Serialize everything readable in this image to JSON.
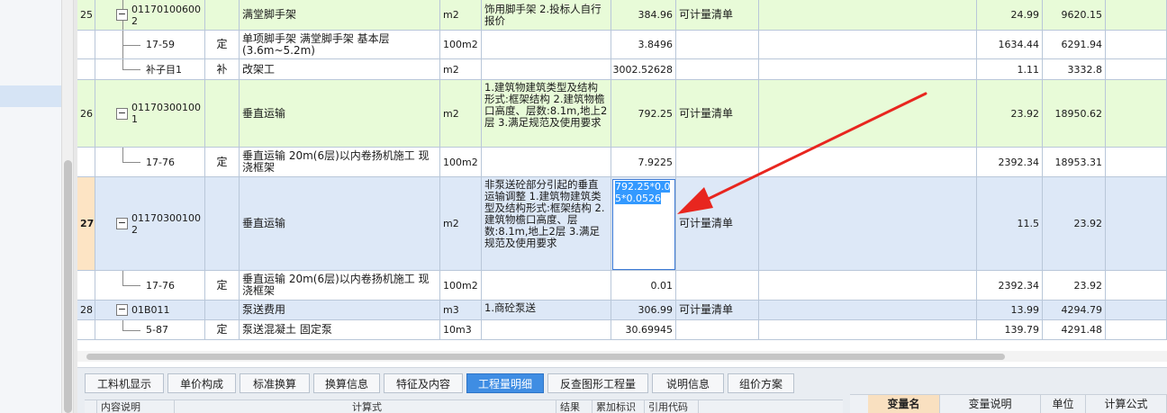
{
  "rows": [
    {
      "num": "25",
      "code": "01170100600 2",
      "name": "满堂脚手架",
      "unit": "m2",
      "features": "饰用脚手架 2.投标人自行报价",
      "qty": "384.96",
      "rule": "可计量清单",
      "price": "24.99",
      "total": "9620.15"
    },
    {
      "num": "",
      "code": "17-59",
      "cat": "定",
      "name": "单项脚手架 满堂脚手架 基本层(3.6m~5.2m)",
      "unit": "100m2",
      "features": "",
      "qty": "3.8496",
      "rule": "",
      "price": "1634.44",
      "total": "6291.94"
    },
    {
      "num": "",
      "code": "补子目1",
      "cat": "补",
      "name": "改架工",
      "unit": "m2",
      "features": "",
      "qty": "3002.52628",
      "rule": "",
      "price": "1.11",
      "total": "3332.8"
    },
    {
      "num": "26",
      "code": "01170300100 1",
      "name": "垂直运输",
      "unit": "m2",
      "features": "1.建筑物建筑类型及结构形式:框架结构 2.建筑物檐口高度、层数:8.1m,地上2层 3.满足规范及使用要求",
      "qty": "792.25",
      "rule": "可计量清单",
      "price": "23.92",
      "total": "18950.62"
    },
    {
      "num": "",
      "code": "17-76",
      "cat": "定",
      "name": "垂直运输 20m(6层)以内卷扬机施工 现浇框架",
      "unit": "100m2",
      "features": "",
      "qty": "7.9225",
      "rule": "",
      "price": "2392.34",
      "total": "18953.31"
    },
    {
      "num": "27",
      "code": "01170300100 2",
      "name": "垂直运输",
      "unit": "m2",
      "features": "非泵送砼部分引起的垂直运输调整 1.建筑物建筑类型及结构形式:框架结构 2.建筑物檐口高度、层数:8.1m,地上2层 3.满足规范及使用要求",
      "qty": "792.25*0.05*0.0526",
      "rule": "可计量清单",
      "price": "11.5",
      "total": "23.92"
    },
    {
      "num": "",
      "code": "17-76",
      "cat": "定",
      "name": "垂直运输 20m(6层)以内卷扬机施工 现浇框架",
      "unit": "100m2",
      "features": "",
      "qty": "0.01",
      "rule": "",
      "price": "2392.34",
      "total": "23.92"
    },
    {
      "num": "28",
      "code": "01B011",
      "name": "泵送费用",
      "unit": "m3",
      "features": "1.商砼泵送",
      "qty": "306.99",
      "rule": "可计量清单",
      "price": "13.99",
      "total": "4294.79"
    },
    {
      "num": "",
      "code": "5-87",
      "cat": "定",
      "name": "泵送混凝土 固定泵",
      "unit": "10m3",
      "features": "",
      "qty": "30.69945",
      "rule": "",
      "price": "139.79",
      "total": "4291.48"
    }
  ],
  "editor": {
    "line1": "792.25*0.0",
    "line2": "5*0.0526"
  },
  "tabs": [
    "工料机显示",
    "单价构成",
    "标准换算",
    "换算信息",
    "特征及内容",
    "工程量明细",
    "反查图形工程量",
    "说明信息",
    "组价方案"
  ],
  "active_tab": "工程量明细",
  "sub_headers": [
    "内容说明",
    "计算式",
    "结果",
    "累加标识",
    "引用代码"
  ],
  "right_headers": [
    "变量名",
    "变量说明",
    "单位",
    "计算公式"
  ],
  "colors": {
    "green_row": "#e8fbd8",
    "blue_row": "#dde8f7",
    "active_tab": "#3f8de3",
    "arrow": "#e8261f"
  }
}
